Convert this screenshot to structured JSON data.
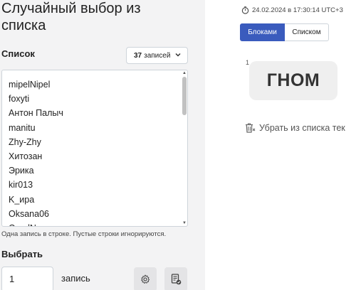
{
  "page": {
    "title": "Случайный выбор из списка"
  },
  "list": {
    "label": "Список",
    "count_value": "37",
    "count_suffix": "записей",
    "items": [
      "mipelNipel",
      "foxyti",
      "Антон Палыч",
      "manitu",
      "Zhy-Zhy",
      "Хитозан",
      "Эрика",
      "kir013",
      "K_ира",
      "Oksana06",
      "CoralN..."
    ],
    "hint": "Одна запись в строке. Пустые строки игнорируются."
  },
  "pick": {
    "label": "Выбрать",
    "value": "1",
    "unit": "запись"
  },
  "result": {
    "timestamp": "24.02.2024 в 17:30:14 UTC+3",
    "view_blocks": "Блоками",
    "view_list": "Списком",
    "index": "1",
    "winner": "ГНОМ",
    "remove_label": "Убрать из списка тек"
  },
  "icons": {
    "clock": "clock-icon",
    "chevron": "chevron-down-icon",
    "settings": "gear-icon",
    "document": "document-check-icon",
    "trash": "trash-icon"
  },
  "colors": {
    "accent": "#3a5bbd",
    "panel": "#f3f3f4"
  }
}
